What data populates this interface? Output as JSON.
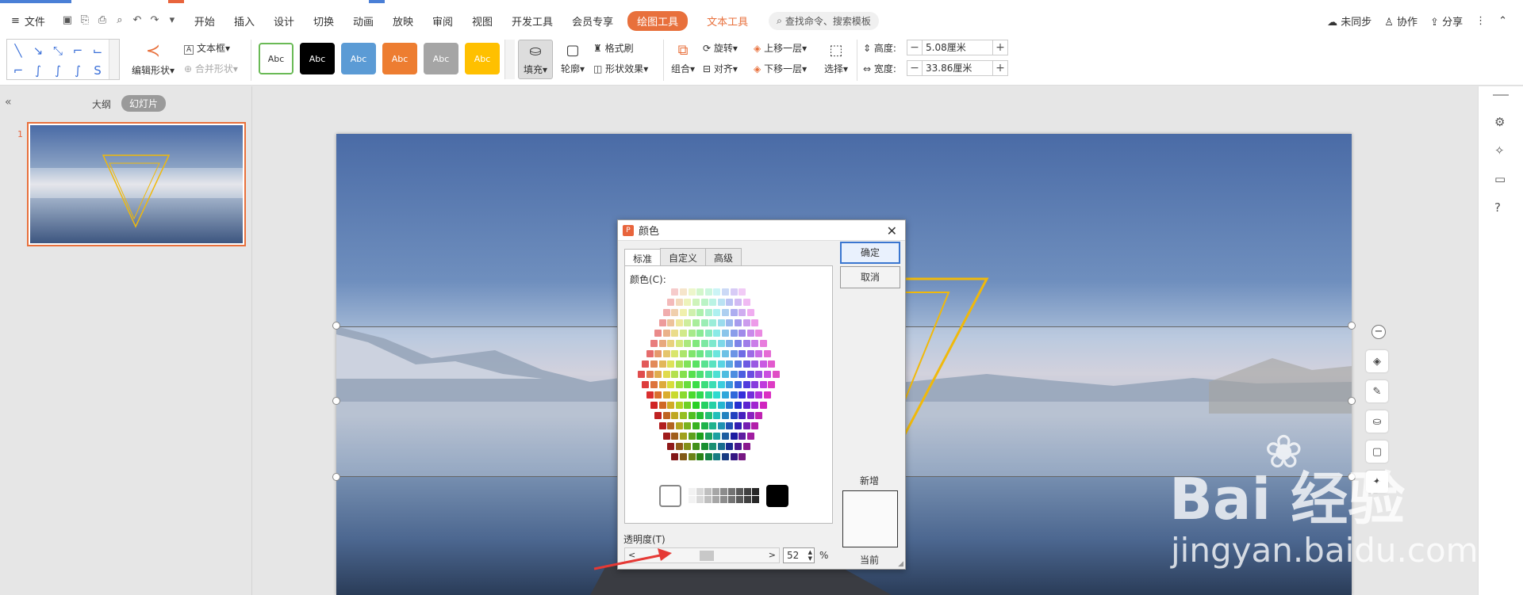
{
  "menubar": {
    "file_label": "文件",
    "items": [
      "开始",
      "插入",
      "设计",
      "切换",
      "动画",
      "放映",
      "审阅",
      "视图",
      "开发工具",
      "会员专享"
    ],
    "drawing_tools": "绘图工具",
    "text_tools": "文本工具",
    "search_placeholder": "查找命令、搜索模板",
    "right": {
      "sync": "未同步",
      "collab": "协作",
      "share": "分享"
    }
  },
  "ribbon": {
    "edit_shape": "编辑形状",
    "textbox": "文本框",
    "merge_shape": "合并形状",
    "style_swatches": [
      {
        "label": "Abc",
        "bg": "#ffffff",
        "fg": "#333333",
        "border": "#6aba56"
      },
      {
        "label": "Abc",
        "bg": "#000000",
        "fg": "#ffffff",
        "border": "#000000"
      },
      {
        "label": "Abc",
        "bg": "#5b9bd5",
        "fg": "#ffffff",
        "border": "#5b9bd5"
      },
      {
        "label": "Abc",
        "bg": "#ed7d31",
        "fg": "#ffffff",
        "border": "#ed7d31"
      },
      {
        "label": "Abc",
        "bg": "#a5a5a5",
        "fg": "#ffffff",
        "border": "#a5a5a5"
      },
      {
        "label": "Abc",
        "bg": "#ffc000",
        "fg": "#ffffff",
        "border": "#ffc000"
      }
    ],
    "fill": "填充",
    "outline": "轮廓",
    "format_painter": "格式刷",
    "shape_effect": "形状效果",
    "group": "组合",
    "rotate": "旋转",
    "align": "对齐",
    "bring_forward": "上移一层",
    "send_backward": "下移一层",
    "select": "选择",
    "height_label": "高度:",
    "height_value": "5.08厘米",
    "width_label": "宽度:",
    "width_value": "33.86厘米"
  },
  "leftpanel": {
    "outline_tab": "大纲",
    "slides_tab": "幻灯片",
    "slide_number": "1"
  },
  "dialog": {
    "title": "颜色",
    "tabs": [
      "标准",
      "自定义",
      "高级"
    ],
    "color_label": "颜色(C):",
    "ok": "确定",
    "cancel": "取消",
    "new_label": "新增",
    "current_label": "当前",
    "transparency_label": "透明度(T)",
    "transparency_value": "52",
    "percent": "%"
  },
  "watermark": {
    "brand": "Bai 经验",
    "url": "jingyan.baidu.com"
  }
}
